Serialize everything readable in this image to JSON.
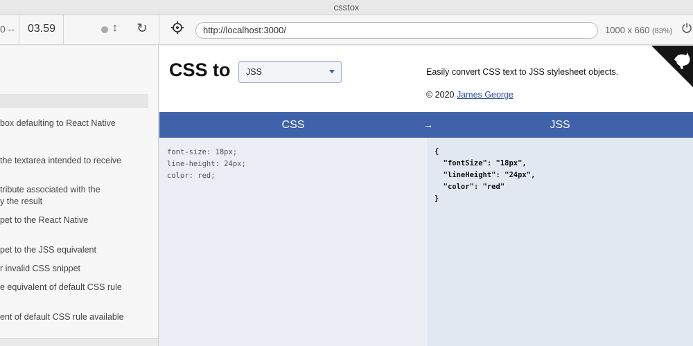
{
  "window": {
    "title": "csstox"
  },
  "toolbar": {
    "left_stub": "0 --",
    "time": "03.59",
    "updown_icon": "updown-arrows-icon",
    "reload_icon": "reload-icon",
    "target_icon": "crosshair-icon",
    "url": "http://localhost:3000/",
    "viewport": "1000 x 660",
    "zoom": "(83%)",
    "power_icon": "power-icon"
  },
  "test_list": {
    "items": [
      "box defaulting to React Native",
      "the textarea intended to receive",
      "tribute associated with the",
      "y the result",
      "pet to the React Native",
      "pet to the JSS equivalent",
      "r invalid CSS snippet",
      "e equivalent of default CSS rule",
      "ent of default CSS rule available"
    ]
  },
  "app": {
    "title": "CSS to",
    "selected_format": "JSS",
    "tagline": "Easily convert CSS text to JSS stylesheet objects.",
    "copyright_prefix": "© 2020",
    "author": "James George",
    "corner_icon": "github-octocat-icon"
  },
  "converter": {
    "left_label": "CSS",
    "arrow": "→",
    "right_label": "JSS",
    "css_input": "font-size: 18px;\nline-height: 24px;\ncolor: red;",
    "jss_output": "{\n  \"fontSize\": \"18px\",\n  \"lineHeight\": \"24px\",\n  \"color\": \"red\"\n}"
  },
  "colors": {
    "header_bar": "#3f62aa",
    "css_pane": "#ebeef4",
    "jss_pane": "#e2e8f2"
  }
}
